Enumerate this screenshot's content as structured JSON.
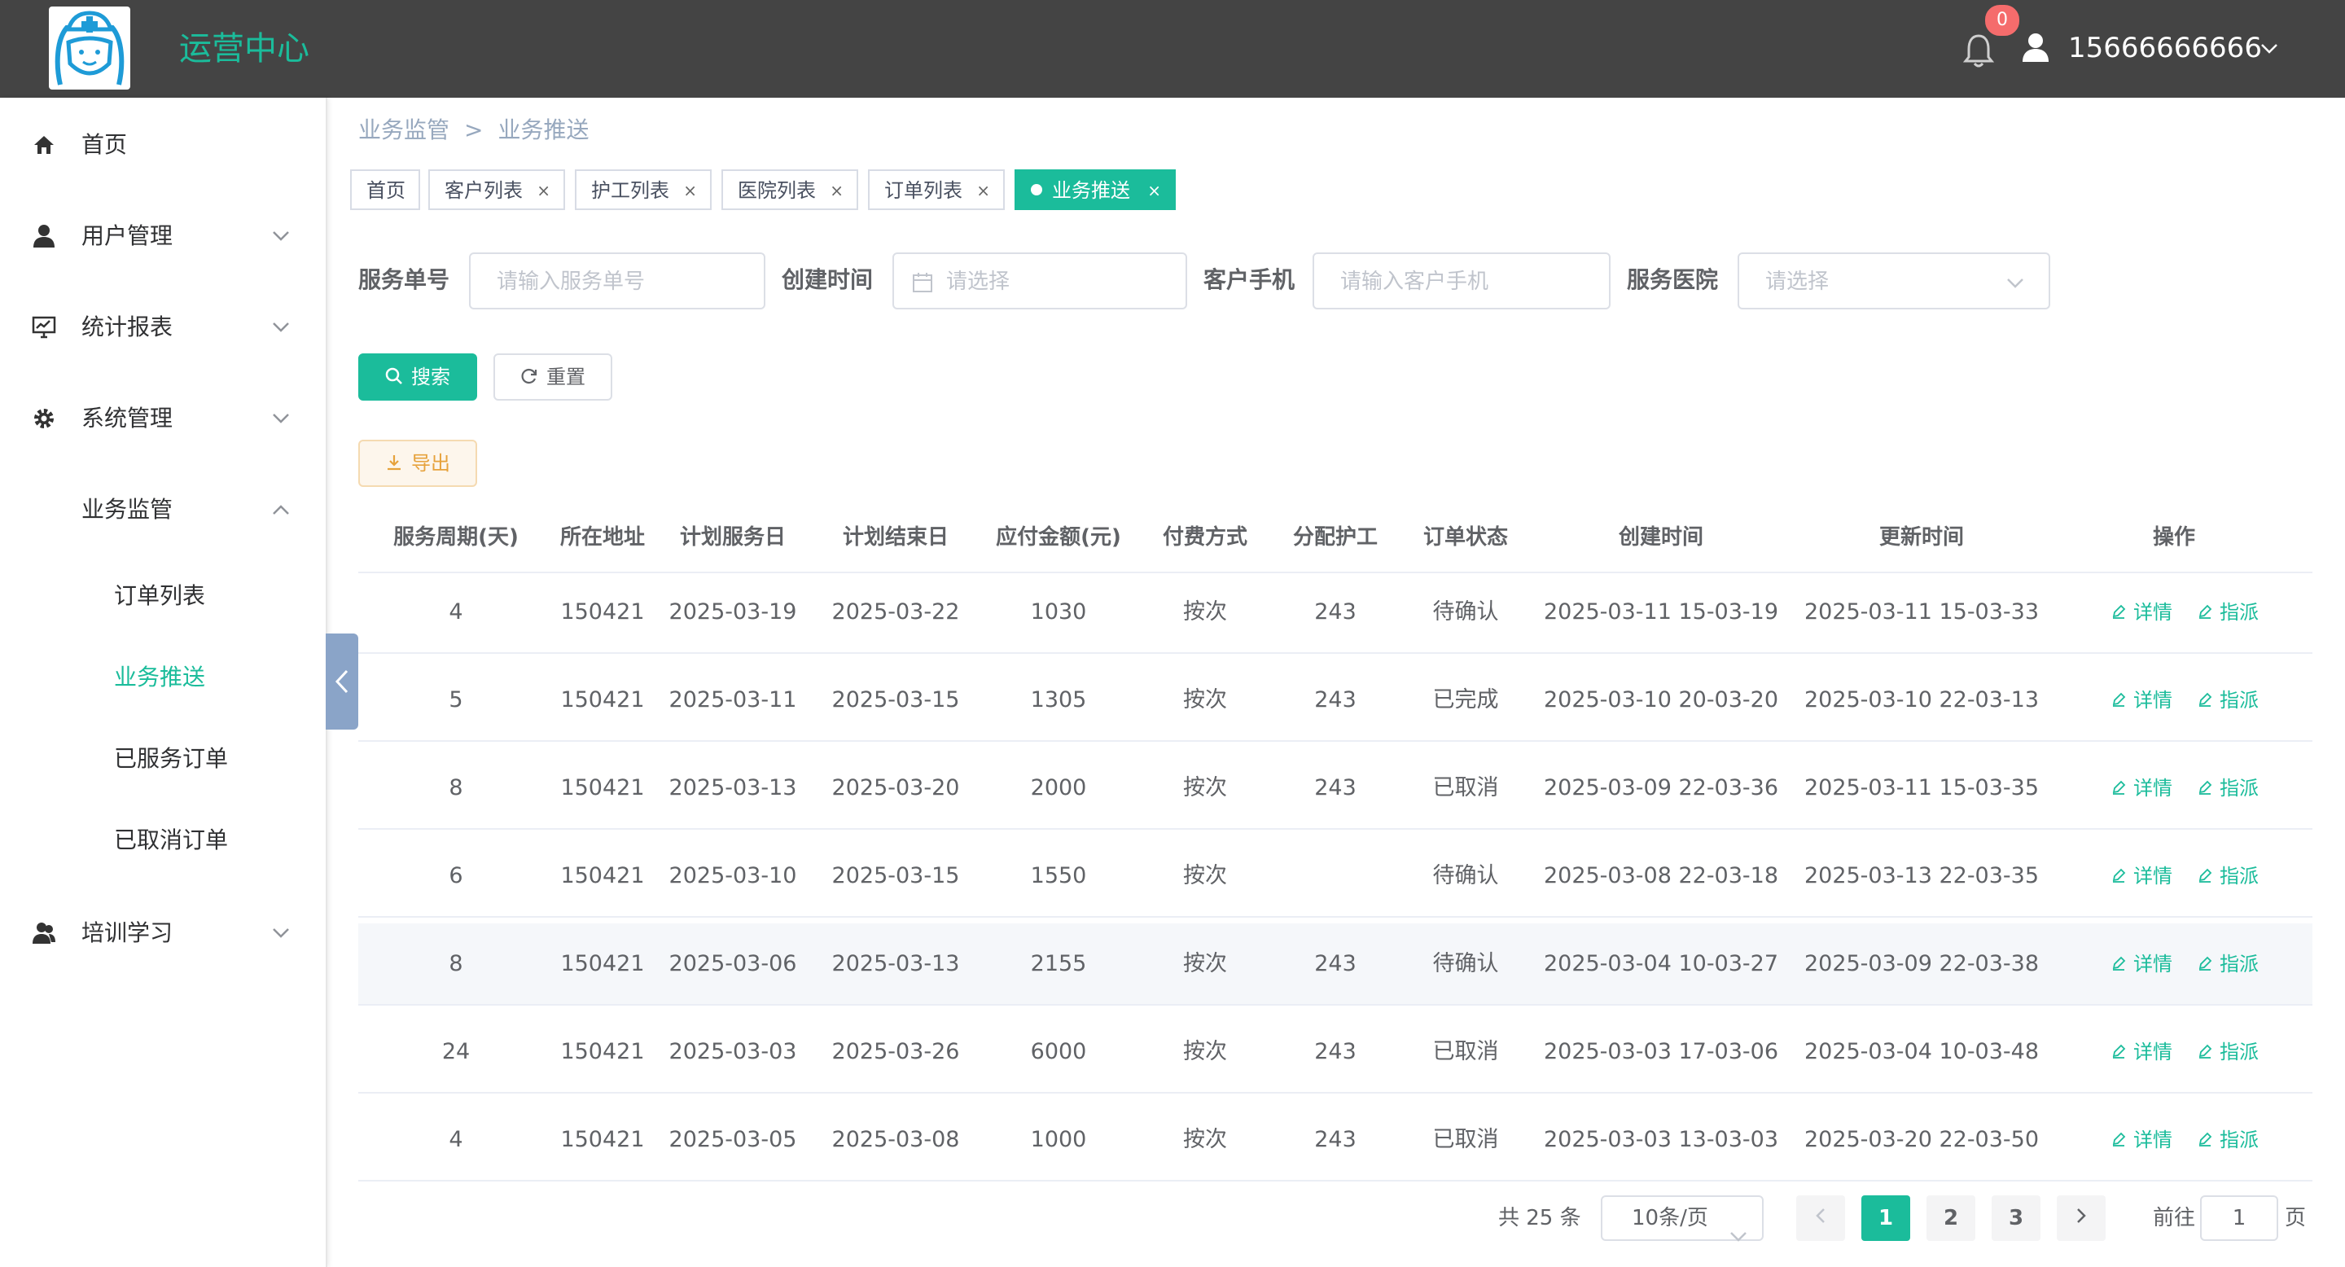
{
  "header": {
    "app_title": "运营中心",
    "notification_count": "0",
    "user_phone": "15666666666"
  },
  "sidebar": {
    "items": [
      {
        "label": "首页",
        "icon": "home-icon"
      },
      {
        "label": "用户管理",
        "icon": "user-icon"
      },
      {
        "label": "统计报表",
        "icon": "chart-monitor-icon"
      },
      {
        "label": "系统管理",
        "icon": "gear-icon"
      },
      {
        "label": "业务监管",
        "icon": "none",
        "expanded": true
      },
      {
        "label": "培训学习",
        "icon": "group-icon"
      }
    ],
    "subitems": [
      {
        "label": "订单列表",
        "active": false
      },
      {
        "label": "业务推送",
        "active": true
      },
      {
        "label": "已服务订单",
        "active": false
      },
      {
        "label": "已取消订单",
        "active": false
      }
    ]
  },
  "breadcrumb": {
    "parent": "业务监管",
    "separator": ">",
    "current": "业务推送"
  },
  "tags": [
    {
      "label": "首页",
      "closable": false
    },
    {
      "label": "客户列表",
      "closable": true
    },
    {
      "label": "护工列表",
      "closable": true
    },
    {
      "label": "医院列表",
      "closable": true
    },
    {
      "label": "订单列表",
      "closable": true
    },
    {
      "label": "业务推送",
      "closable": true,
      "active": true
    }
  ],
  "tag_close_glyph": "×",
  "filters": {
    "order_no": {
      "label": "服务单号",
      "placeholder": "请输入服务单号"
    },
    "create_time": {
      "label": "创建时间",
      "placeholder": "请选择"
    },
    "customer_phone": {
      "label": "客户手机",
      "placeholder": "请输入客户手机"
    },
    "hospital": {
      "label": "服务医院",
      "placeholder": "请选择"
    }
  },
  "buttons": {
    "search": "搜索",
    "reset": "重置",
    "export": "导出"
  },
  "table": {
    "columns": [
      "服务周期(天)",
      "所在地址",
      "计划服务日",
      "计划结束日",
      "应付金额(元)",
      "付费方式",
      "分配护工",
      "订单状态",
      "创建时间",
      "更新时间",
      "操作"
    ],
    "rows": [
      [
        "4",
        "150421",
        "2025-03-19",
        "2025-03-22",
        "1030",
        "按次",
        "243",
        "待确认",
        "2025-03-11 15-03-19",
        "2025-03-11 15-03-33"
      ],
      [
        "5",
        "150421",
        "2025-03-11",
        "2025-03-15",
        "1305",
        "按次",
        "243",
        "已完成",
        "2025-03-10 20-03-20",
        "2025-03-10 22-03-13"
      ],
      [
        "8",
        "150421",
        "2025-03-13",
        "2025-03-20",
        "2000",
        "按次",
        "243",
        "已取消",
        "2025-03-09 22-03-36",
        "2025-03-11 15-03-35"
      ],
      [
        "6",
        "150421",
        "2025-03-10",
        "2025-03-15",
        "1550",
        "按次",
        "",
        "待确认",
        "2025-03-08 22-03-18",
        "2025-03-13 22-03-35"
      ],
      [
        "8",
        "150421",
        "2025-03-06",
        "2025-03-13",
        "2155",
        "按次",
        "243",
        "待确认",
        "2025-03-04 10-03-27",
        "2025-03-09 22-03-38"
      ],
      [
        "24",
        "150421",
        "2025-03-03",
        "2025-03-26",
        "6000",
        "按次",
        "243",
        "已取消",
        "2025-03-03 17-03-06",
        "2025-03-04 10-03-48"
      ],
      [
        "4",
        "150421",
        "2025-03-05",
        "2025-03-08",
        "1000",
        "按次",
        "243",
        "已取消",
        "2025-03-03 13-03-03",
        "2025-03-20 22-03-50"
      ]
    ],
    "highlighted_row": 4,
    "actions": {
      "detail": "详情",
      "assign": "指派"
    }
  },
  "pagination": {
    "total": "共 25 条",
    "page_size": "10条/页",
    "pages": [
      "1",
      "2",
      "3"
    ],
    "current_page": "1",
    "goto_label": "前往",
    "goto_value": "1",
    "page_suffix": "页"
  },
  "colors": {
    "header_bg": "#444444",
    "accent": "#1bbc9b",
    "badge": "#f56c6c",
    "export_warning": "#e6a23c"
  }
}
